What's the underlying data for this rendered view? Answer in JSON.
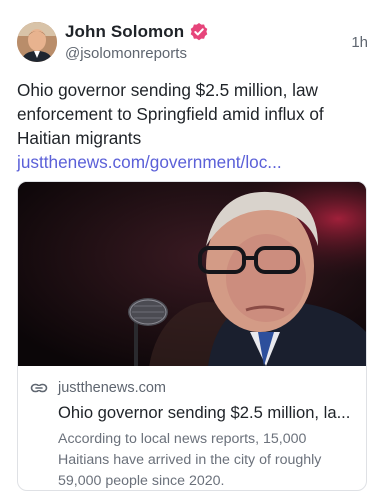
{
  "author": {
    "display_name": "John Solomon",
    "handle": "@jsolomonreports",
    "avatar_icon": "person-avatar",
    "verified_icon": "verified-badge-icon",
    "verified_color": "#e6447a"
  },
  "post": {
    "timestamp": "1h",
    "text": "Ohio governor sending $2.5 million, law enforcement to Springfield amid influx of Haitian migrants ",
    "link_text": "justthenews.com/government/loc...",
    "link_color": "#5b60d8"
  },
  "link_card": {
    "image_icon": "news-photo",
    "link_icon": "link-icon",
    "domain": "justthenews.com",
    "title": "Ohio governor sending $2.5 million, la...",
    "description": "According to local news reports, 15,000 Haitians have arrived in the city of roughly 59,000 people since 2020."
  }
}
